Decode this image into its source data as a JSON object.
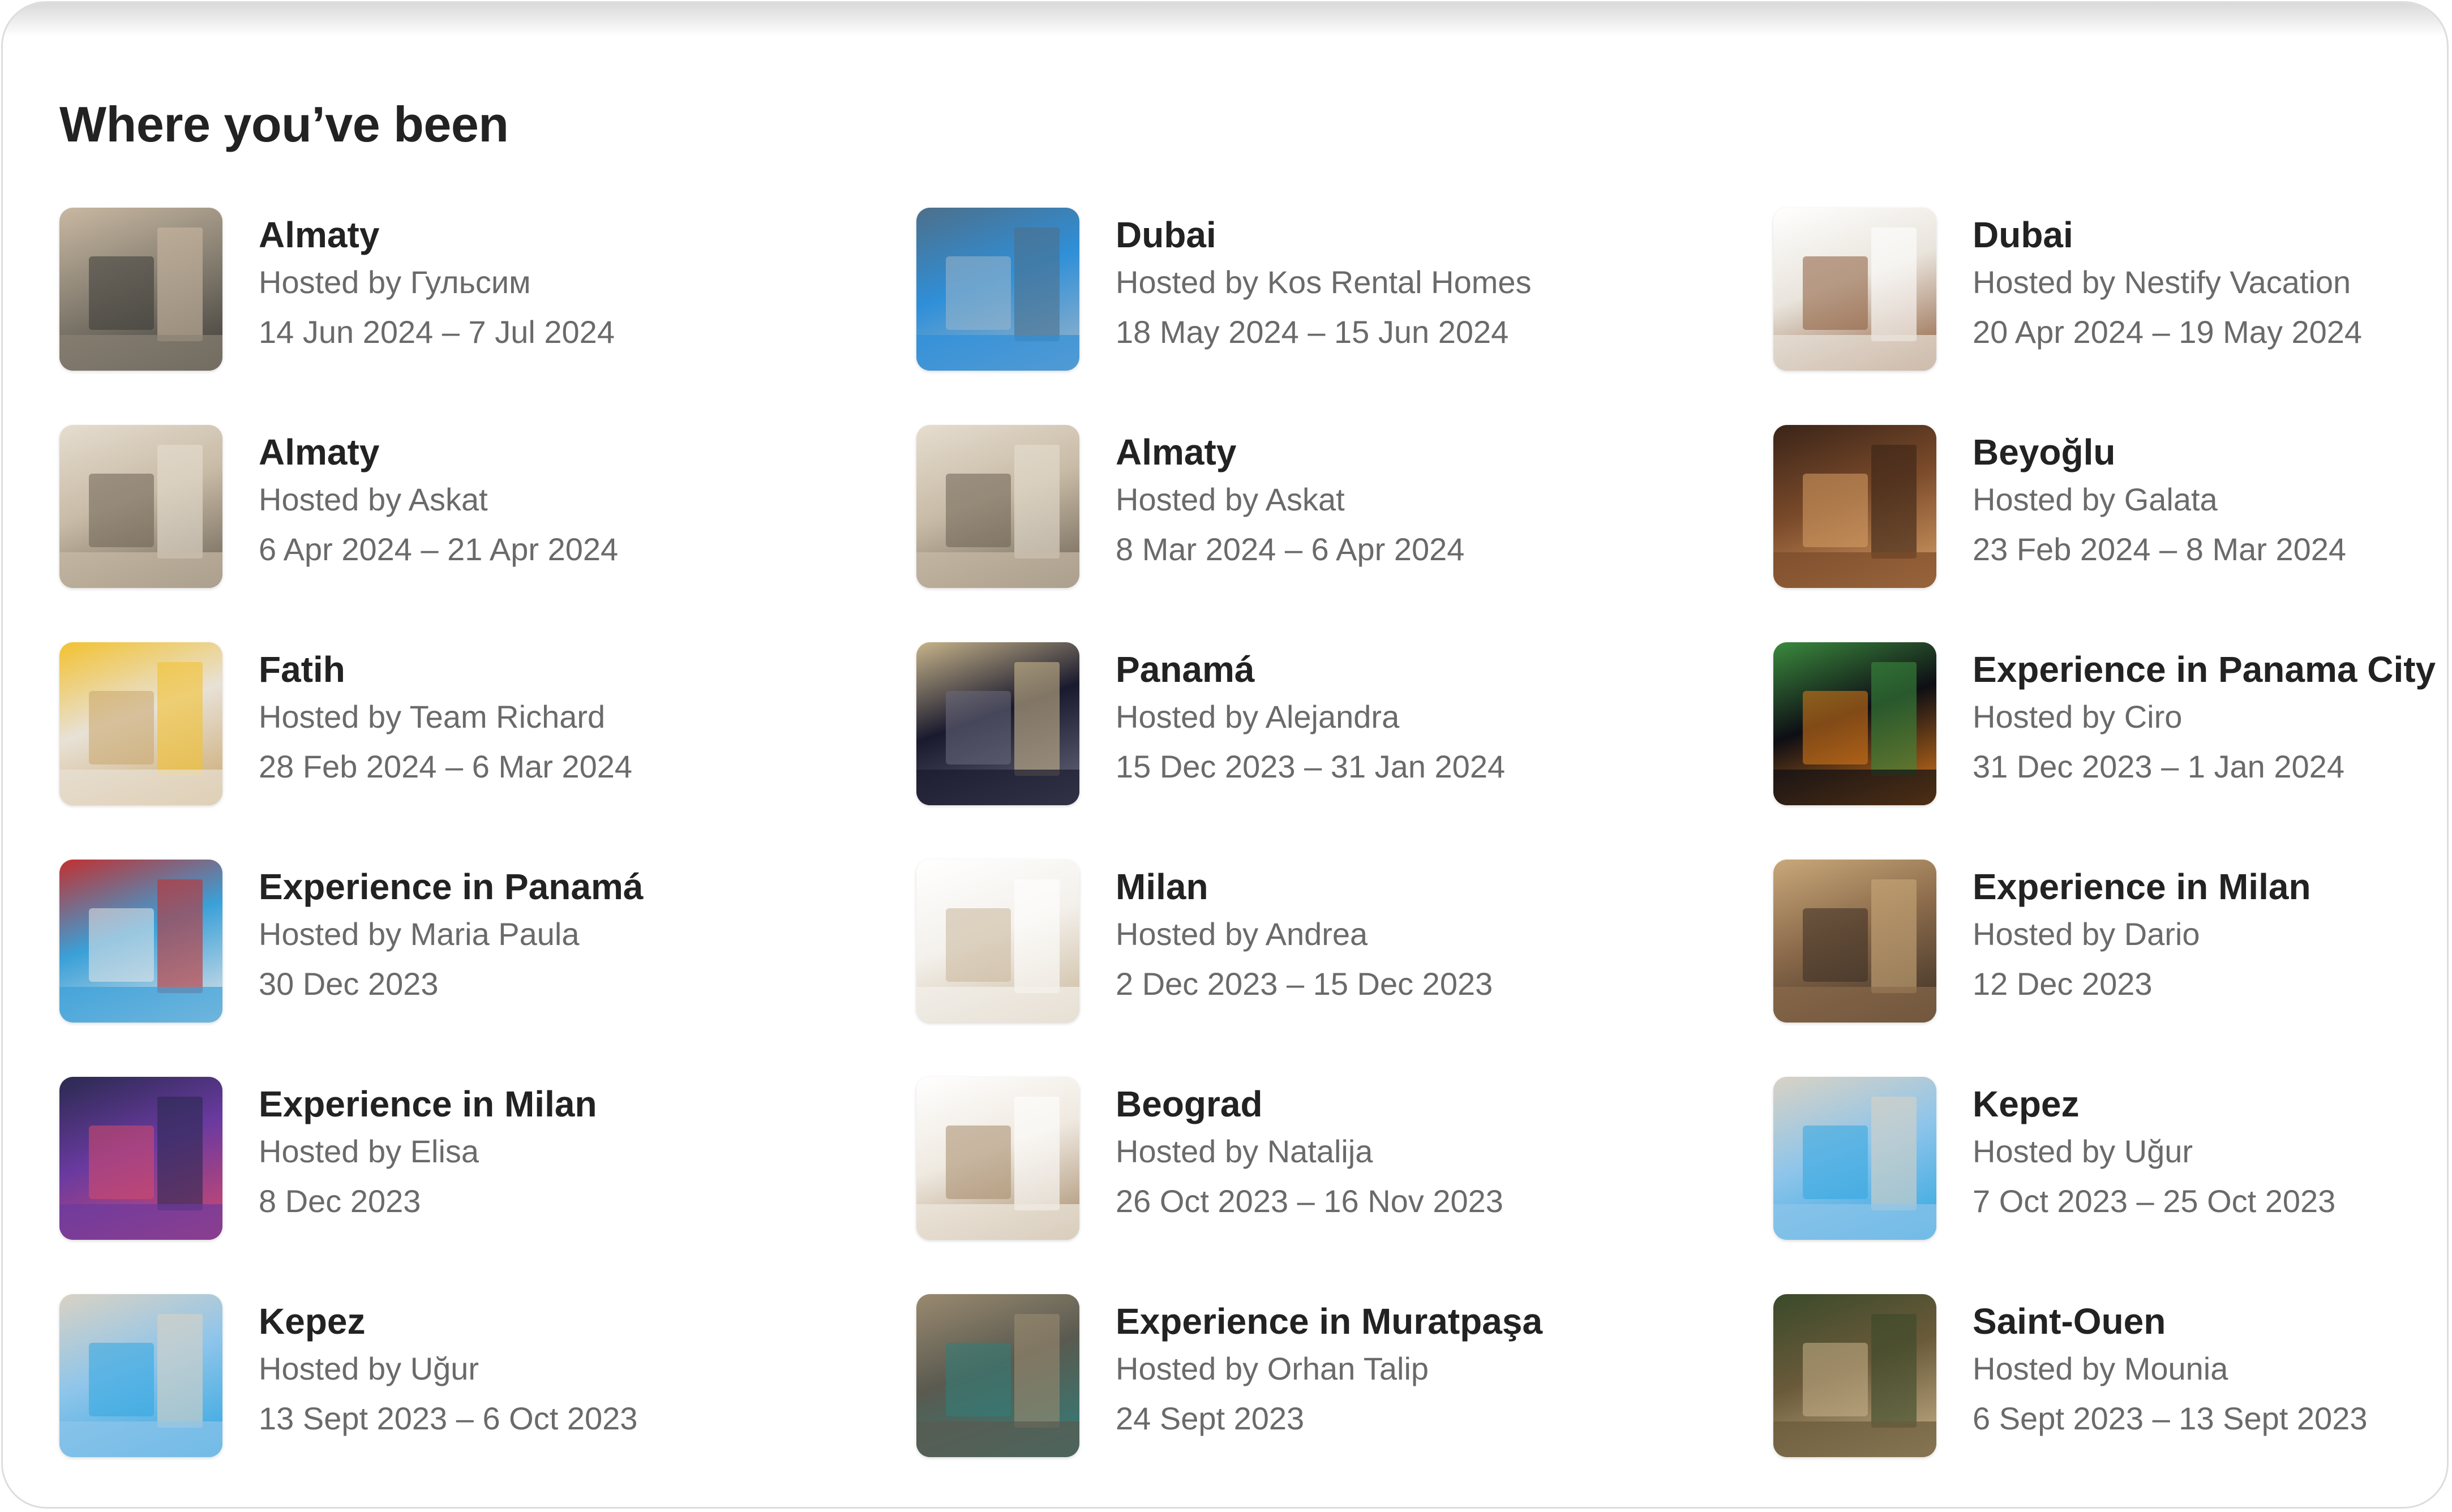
{
  "section_title": "Where you’ve been",
  "trips": [
    {
      "place": "Almaty",
      "host": "Hosted by Гульсим",
      "dates": "14 Jun 2024 – 7 Jul 2024",
      "thumb": "apartment-living-room-photo",
      "c1": "#8a8274",
      "c2": "#3b3a37",
      "c3": "#c9b8a2"
    },
    {
      "place": "Dubai",
      "host": "Hosted by Kos Rental Homes",
      "dates": "18 May 2024 – 15 Jun 2024",
      "thumb": "skyscrapers-photo",
      "c1": "#2f8fd8",
      "c2": "#9fb7c9",
      "c3": "#4d6f8a"
    },
    {
      "place": "Dubai",
      "host": "Hosted by Nestify Vacation",
      "dates": "20 Apr 2024 – 19 May 2024",
      "thumb": "hotel-bedroom-photo",
      "c1": "#e9e4dc",
      "c2": "#8c5b3a",
      "c3": "#ffffff"
    },
    {
      "place": "Almaty",
      "host": "Hosted by Askat",
      "dates": "6 Apr 2024 – 21 Apr 2024",
      "thumb": "living-room-photo",
      "c1": "#c8bba6",
      "c2": "#6b6053",
      "c3": "#e6ddd0"
    },
    {
      "place": "Almaty",
      "host": "Hosted by Askat",
      "dates": "8 Mar 2024 – 6 Apr 2024",
      "thumb": "living-room-photo",
      "c1": "#c8bba6",
      "c2": "#6b6053",
      "c3": "#e6ddd0"
    },
    {
      "place": "Beyoğlu",
      "host": "Hosted by Galata",
      "dates": "23 Feb 2024 – 8 Mar 2024",
      "thumb": "dining-room-photo",
      "c1": "#7a4a2a",
      "c2": "#d9a066",
      "c3": "#3a2418"
    },
    {
      "place": "Fatih",
      "host": "Hosted by Team Richard",
      "dates": "28 Feb 2024 – 6 Mar 2024",
      "thumb": "bedroom-photo",
      "c1": "#e8e1d6",
      "c2": "#c9a66b",
      "c3": "#f2c230"
    },
    {
      "place": "Panamá",
      "host": "Hosted by Alejandra",
      "dates": "15 Dec 2023 – 31 Jan 2024",
      "thumb": "night-tower-photo",
      "c1": "#1a1a2e",
      "c2": "#6b6b80",
      "c3": "#c7b48a"
    },
    {
      "place": "Experience in Panama City",
      "host": "Hosted by Ciro",
      "dates": "31 Dec 2023 – 1 Jan 2024",
      "thumb": "party-photo",
      "c1": "#0e0e14",
      "c2": "#e07b1a",
      "c3": "#3b8a3e"
    },
    {
      "place": "Experience in Panamá",
      "host": "Hosted by Maria Paula",
      "dates": "30 Dec 2023",
      "thumb": "boat-party-photo",
      "c1": "#3aa0d8",
      "c2": "#e8e8e8",
      "c3": "#c23030"
    },
    {
      "place": "Milan",
      "host": "Hosted by Andrea",
      "dates": "2 Dec 2023 – 15 Dec 2023",
      "thumb": "bright-bedroom-photo",
      "c1": "#f4f1ec",
      "c2": "#c9b79a",
      "c3": "#ffffff"
    },
    {
      "place": "Experience in Milan",
      "host": "Hosted by Dario",
      "dates": "12 Dec 2023",
      "thumb": "last-supper-photo",
      "c1": "#8a6a4a",
      "c2": "#3a2e24",
      "c3": "#c9a87a"
    },
    {
      "place": "Experience in Milan",
      "host": "Hosted by Elisa",
      "dates": "8 Dec 2023",
      "thumb": "group-selfie-photo",
      "c1": "#6a3aa0",
      "c2": "#d84a6a",
      "c3": "#2a2a50"
    },
    {
      "place": "Beograd",
      "host": "Hosted by Natalija",
      "dates": "26 Oct 2023 – 16 Nov 2023",
      "thumb": "studio-apartment-photo",
      "c1": "#efe9e0",
      "c2": "#a58a6a",
      "c3": "#ffffff"
    },
    {
      "place": "Kepez",
      "host": "Hosted by Uğur",
      "dates": "7 Oct 2023 – 25 Oct 2023",
      "thumb": "pool-photo",
      "c1": "#8fc5ea",
      "c2": "#2fa6e0",
      "c3": "#d9d2c4"
    },
    {
      "place": "Kepez",
      "host": "Hosted by Uğur",
      "dates": "13 Sept 2023 – 6 Oct 2023",
      "thumb": "pool-photo",
      "c1": "#8fc5ea",
      "c2": "#2fa6e0",
      "c3": "#d9d2c4"
    },
    {
      "place": "Experience in Muratpaşa",
      "host": "Hosted by Orhan Talip",
      "dates": "24 Sept 2023",
      "thumb": "sea-cave-photo",
      "c1": "#5a5a50",
      "c2": "#2f7f7a",
      "c3": "#9a8a70"
    },
    {
      "place": "Saint-Ouen",
      "host": "Hosted by Mounia",
      "dates": "6 Sept 2023 – 13 Sept 2023",
      "thumb": "boho-living-room-photo",
      "c1": "#6a5a3a",
      "c2": "#c9b38a",
      "c3": "#3a4a2a"
    }
  ]
}
